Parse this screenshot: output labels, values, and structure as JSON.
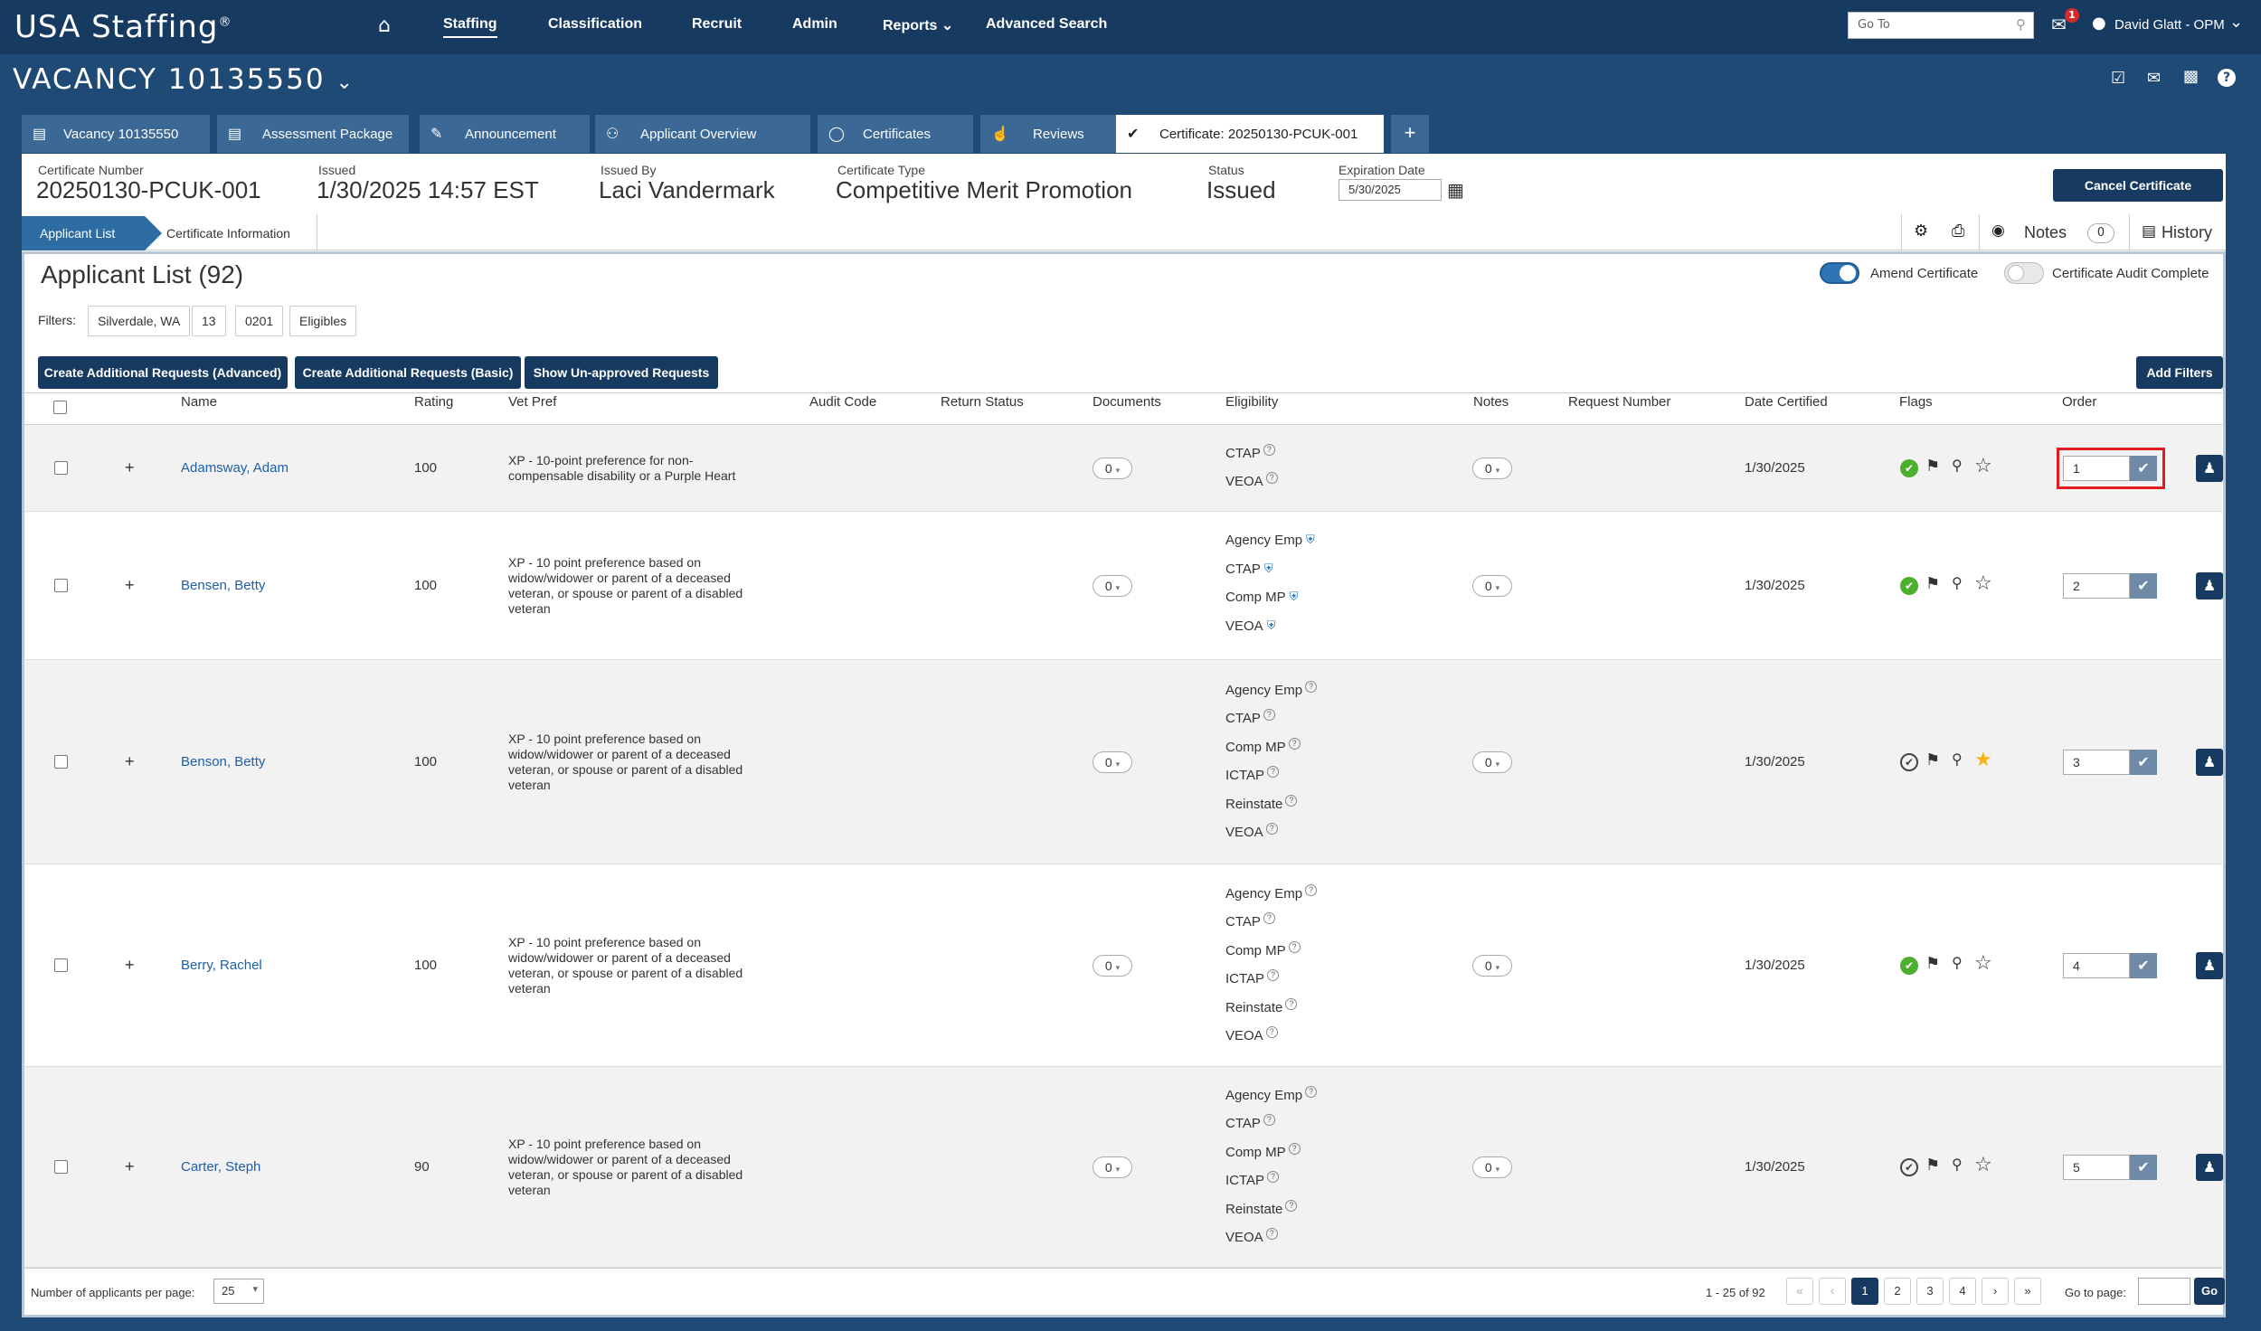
{
  "nav": {
    "logo": "USA Staffing",
    "logo_mark": "®",
    "items": [
      "Staffing",
      "Classification",
      "Recruit",
      "Admin",
      "Reports",
      "Advanced Search"
    ],
    "goto_placeholder": "Go To",
    "mail_count": "1",
    "user": "David Glatt - OPM"
  },
  "vacancy": {
    "title": "VACANCY 10135550"
  },
  "tabs": [
    "Vacancy 10135550",
    "Assessment Package",
    "Announcement",
    "Applicant Overview",
    "Certificates",
    "Reviews",
    "Certificate: 20250130-PCUK-001"
  ],
  "cert_header": {
    "number_label": "Certificate Number",
    "number": "20250130-PCUK-001",
    "issued_label": "Issued",
    "issued": "1/30/2025 14:57 EST",
    "issued_by_label": "Issued By",
    "issued_by": "Laci Vandermark",
    "type_label": "Certificate Type",
    "type": "Competitive Merit Promotion",
    "status_label": "Status",
    "status": "Issued",
    "exp_label": "Expiration Date",
    "exp": "5/30/2025",
    "cancel_button": "Cancel Certificate"
  },
  "subtabs": {
    "applicant_list": "Applicant List",
    "cert_info": "Certificate Information",
    "notes": "Notes",
    "notes_count": "0",
    "history": "History"
  },
  "list": {
    "title": "Applicant List (92)",
    "amend": "Amend Certificate",
    "audit": "Certificate Audit Complete",
    "filters_label": "Filters:",
    "filters": [
      "Silverdale, WA",
      "13",
      "0201",
      "Eligibles"
    ],
    "btn_adv": "Create Additional Requests (Advanced)",
    "btn_basic": "Create Additional Requests (Basic)",
    "btn_unapproved": "Show Un-approved Requests",
    "btn_add_filters": "Add Filters"
  },
  "columns": [
    "Name",
    "Rating",
    "Vet Pref",
    "Audit Code",
    "Return Status",
    "Documents",
    "Eligibility",
    "Notes",
    "Request Number",
    "Date Certified",
    "Flags",
    "Order"
  ],
  "rows": [
    {
      "name": "Adamsway, Adam",
      "rating": "100",
      "vet": [
        "XP - 10-point preference for non-",
        "compensable disability or a Purple Heart"
      ],
      "docs": "0",
      "elig": [
        "CTAP",
        "VEOA"
      ],
      "verified": false,
      "notes": "0",
      "date": "1/30/2025",
      "order": "1",
      "check": "green",
      "star": false
    },
    {
      "name": "Bensen, Betty",
      "rating": "100",
      "vet": [
        "XP - 10 point preference based on",
        "widow/widower or parent of a deceased",
        "veteran, or spouse or parent of a disabled",
        "veteran"
      ],
      "docs": "0",
      "elig": [
        "Agency Emp",
        "CTAP",
        "Comp MP",
        "VEOA"
      ],
      "verified": true,
      "notes": "0",
      "date": "1/30/2025",
      "order": "2",
      "check": "green",
      "star": false
    },
    {
      "name": "Benson, Betty",
      "rating": "100",
      "vet": [
        "XP - 10 point preference based on",
        "widow/widower or parent of a deceased",
        "veteran, or spouse or parent of a disabled",
        "veteran"
      ],
      "docs": "0",
      "elig": [
        "Agency Emp",
        "CTAP",
        "Comp MP",
        "ICTAP",
        "Reinstate",
        "VEOA"
      ],
      "verified": false,
      "notes": "0",
      "date": "1/30/2025",
      "order": "3",
      "check": "outline",
      "star": true
    },
    {
      "name": "Berry, Rachel",
      "rating": "100",
      "vet": [
        "XP - 10 point preference based on",
        "widow/widower or parent of a deceased",
        "veteran, or spouse or parent of a disabled",
        "veteran"
      ],
      "docs": "0",
      "elig": [
        "Agency Emp",
        "CTAP",
        "Comp MP",
        "ICTAP",
        "Reinstate",
        "VEOA"
      ],
      "verified": false,
      "notes": "0",
      "date": "1/30/2025",
      "order": "4",
      "check": "green",
      "star": false
    },
    {
      "name": "Carter, Steph",
      "rating": "90",
      "vet": [
        "XP - 10 point preference based on",
        "widow/widower or parent of a deceased",
        "veteran, or spouse or parent of a disabled",
        "veteran"
      ],
      "docs": "0",
      "elig": [
        "Agency Emp",
        "CTAP",
        "Comp MP",
        "ICTAP",
        "Reinstate",
        "VEOA"
      ],
      "verified": false,
      "notes": "0",
      "date": "1/30/2025",
      "order": "5",
      "check": "outline",
      "star": false
    }
  ],
  "footer": {
    "per_page_label": "Number of applicants per page:",
    "per_page": "25",
    "range": "1 - 25 of 92",
    "pages": [
      "1",
      "2",
      "3",
      "4"
    ],
    "goto_label": "Go to page:",
    "go": "Go"
  },
  "colors": {
    "navy": "#173b60",
    "blue_bg": "#1f4a75",
    "tab": "#3c6896",
    "link": "#1d5fa8",
    "green": "#4caf2e",
    "star": "#f3b614",
    "highlight": "#e11b22"
  }
}
